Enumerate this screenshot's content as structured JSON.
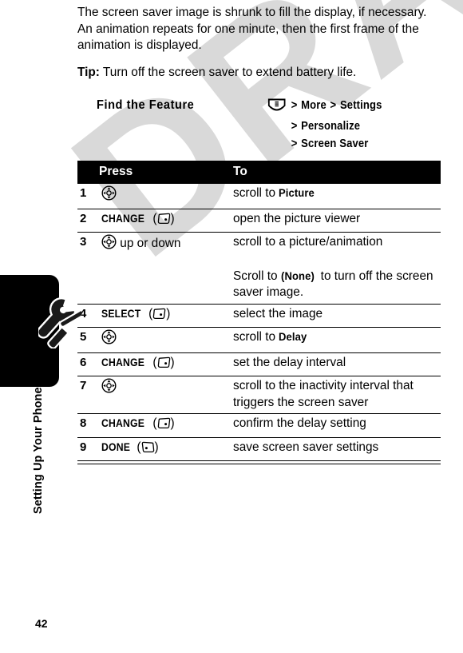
{
  "page": {
    "number": "42",
    "watermark": "DRAFT",
    "sidebar_label": "Setting Up Your Phone",
    "sidebar_icon": "wrench-tool-icon"
  },
  "body": {
    "intro_paragraph": "The screen saver image is shrunk to fill the display, if necessary. An animation repeats for one minute, then the first frame of the animation is displayed.",
    "tip_label": "Tip:",
    "tip_text": " Turn off the screen saver to extend battery life."
  },
  "find_feature": {
    "title": "Find the Feature",
    "menu_icon": "menu-key-icon",
    "path_lines": [
      {
        "icon": "menu-key-icon",
        "sep": ">",
        "items": [
          "More",
          "Settings"
        ],
        "indent": false
      },
      {
        "icon": "",
        "sep": ">",
        "items": [
          "Personalize"
        ],
        "indent": true
      },
      {
        "icon": "",
        "sep": ">",
        "items": [
          "Screen Saver"
        ],
        "indent": true
      }
    ],
    "line1_item1": "More",
    "line1_item2": "Settings",
    "line2_item1": "Personalize",
    "line3_item1": "Screen Saver"
  },
  "steps_table": {
    "headers": {
      "num": "",
      "press": "Press",
      "to": "To"
    },
    "rows": [
      {
        "num": "1",
        "press_icon": "nav-key-icon",
        "press_text": "",
        "press_key": "",
        "to_prefix": "scroll to ",
        "to_bold": "Picture",
        "to_suffix": ""
      },
      {
        "num": "2",
        "press_icon": "left-softkey-icon",
        "press_key": "CHANGE",
        "press_text": "",
        "to_prefix": "open the picture viewer",
        "to_bold": "",
        "to_suffix": ""
      },
      {
        "num": "3",
        "press_icon": "nav-key-icon",
        "press_key": "",
        "press_text": " up or down",
        "to_prefix": "scroll to a picture/animation",
        "to_bold": "",
        "to_suffix": ""
      },
      {
        "num": "",
        "press_icon": "",
        "press_key": "",
        "press_text": "",
        "to_prefix": "Scroll to ",
        "to_bold": "(None)",
        "to_suffix": " to turn off the screen saver image."
      },
      {
        "num": "4",
        "press_icon": "left-softkey-icon",
        "press_key": "SELECT",
        "press_text": "",
        "to_prefix": "select the image",
        "to_bold": "",
        "to_suffix": ""
      },
      {
        "num": "5",
        "press_icon": "nav-key-icon",
        "press_key": "",
        "press_text": "",
        "to_prefix": "scroll to ",
        "to_bold": "Delay",
        "to_suffix": ""
      },
      {
        "num": "6",
        "press_icon": "left-softkey-icon",
        "press_key": "CHANGE",
        "press_text": "",
        "to_prefix": "set the delay interval",
        "to_bold": "",
        "to_suffix": ""
      },
      {
        "num": "7",
        "press_icon": "nav-key-icon",
        "press_key": "",
        "press_text": "",
        "to_prefix": "scroll to the inactivity interval that triggers the screen saver",
        "to_bold": "",
        "to_suffix": ""
      },
      {
        "num": "8",
        "press_icon": "left-softkey-icon",
        "press_key": "CHANGE",
        "press_text": "",
        "to_prefix": "confirm the delay setting",
        "to_bold": "",
        "to_suffix": ""
      },
      {
        "num": "9",
        "press_icon": "right-softkey-icon",
        "press_key": "DONE",
        "press_text": "",
        "to_prefix": "save screen saver settings",
        "to_bold": "",
        "to_suffix": ""
      }
    ]
  },
  "colors": {
    "text": "#000000",
    "header_bg": "#000000",
    "header_fg": "#ffffff",
    "watermark": "#d9d9d9"
  }
}
